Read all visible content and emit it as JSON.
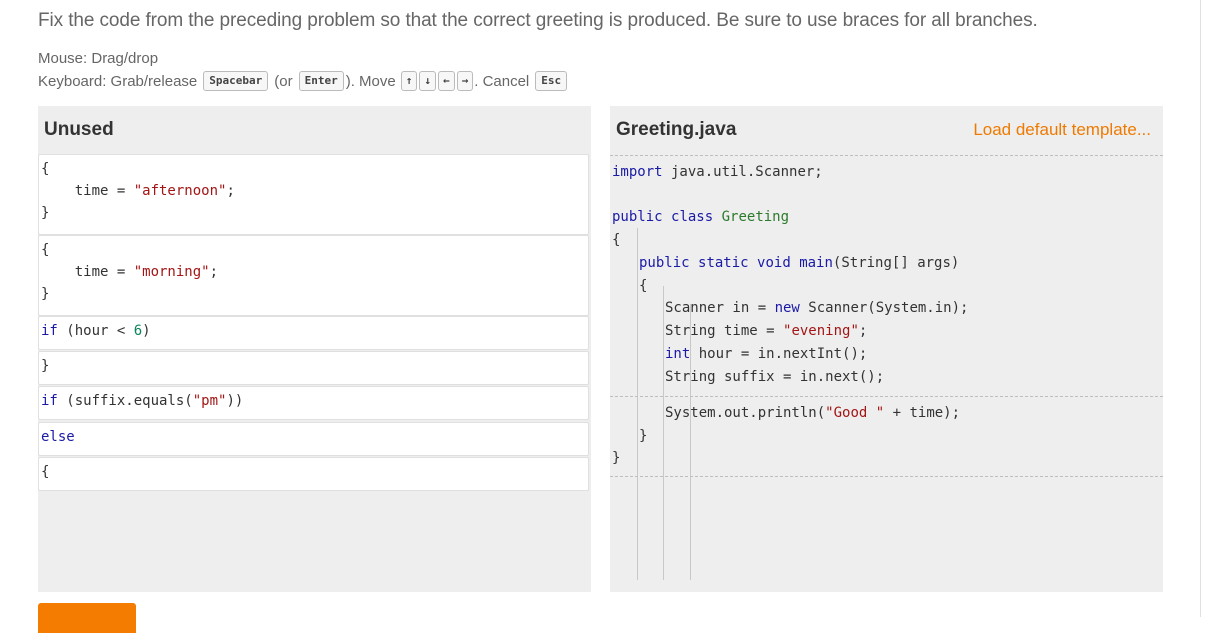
{
  "prompt": "Fix the code from the preceding problem so that the correct greeting is produced. Be sure to use braces for all branches.",
  "instructions": {
    "mouse": "Mouse: Drag/drop",
    "keyboard_prefix": "Keyboard: Grab/release",
    "spacebar": "Spacebar",
    "or_open": "(or",
    "enter": "Enter",
    "close_move": "). Move",
    "up": "↑",
    "down": "↓",
    "left": "←",
    "right": "→",
    "cancel": ". Cancel",
    "esc": "Esc"
  },
  "unused": {
    "title": "Unused",
    "blocks": [
      {
        "lines": [
          "{",
          "    time = \"afternoon\";",
          "}"
        ]
      },
      {
        "lines": [
          "{",
          "    time = \"morning\";",
          "}"
        ]
      },
      {
        "lines": [
          "if (hour < 6)"
        ]
      },
      {
        "lines": [
          "}"
        ]
      },
      {
        "lines": [
          "if (suffix.equals(\"pm\"))"
        ]
      },
      {
        "lines": [
          "else"
        ]
      },
      {
        "lines": [
          "{"
        ]
      }
    ]
  },
  "editor": {
    "title": "Greeting.java",
    "load_template": "Load default template...",
    "import_line": "import java.util.Scanner;",
    "class_line": "public class Greeting",
    "open_class": "{",
    "main_line": "public static void main(String[] args)",
    "open_main": "{",
    "body": [
      "Scanner in = new Scanner(System.in);",
      "String time = \"evening\";",
      "int hour = in.nextInt();",
      "String suffix = in.next();"
    ],
    "print_line": "System.out.println(\"Good \" + time);",
    "close_main": "}",
    "close_class": "}"
  }
}
